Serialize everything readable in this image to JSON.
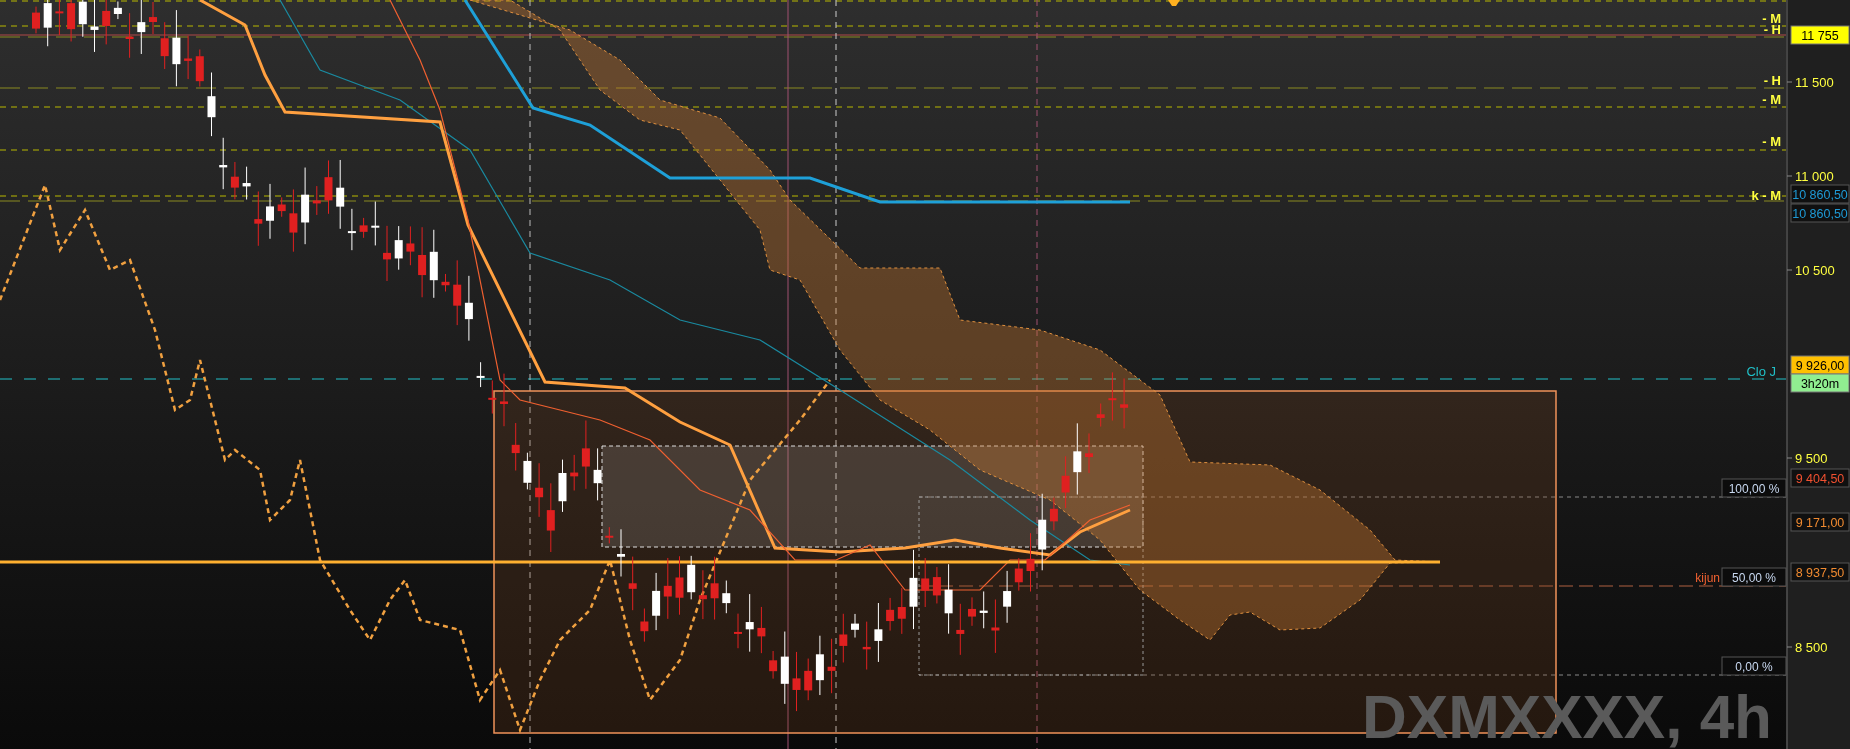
{
  "chart": {
    "level_labels": [
      "- M",
      "- H",
      "- H",
      "- M",
      "- M",
      "k - M"
    ],
    "close_label": "Clo J",
    "fib_labels": [
      {
        "text": "100,00 %"
      },
      {
        "text": "50,00 %"
      },
      {
        "text": "0,00 %"
      }
    ],
    "kijun_label": "kijun",
    "symbol_watermark": "DXMXXXX, 4h"
  },
  "price_axis": {
    "ticks": [
      "11 500",
      "11 000",
      "10 500",
      "9 500",
      "8 500"
    ],
    "price_tags": [
      {
        "text": "11 755",
        "kind": "filled",
        "color": "#ffff00"
      },
      {
        "text": "10 860,50",
        "kind": "outline",
        "color": "#1e9ad6"
      },
      {
        "text": "10 860,50",
        "kind": "outline",
        "color": "#1e9ad6"
      },
      {
        "text": "9 926,00",
        "kind": "filled",
        "color": "#ffc000"
      },
      {
        "text": "3h20m",
        "kind": "filled",
        "color": "#90ee90"
      },
      {
        "text": "9 404,50",
        "kind": "outline",
        "color": "#f05030"
      },
      {
        "text": "9 171,00",
        "kind": "outline",
        "color": "#f08a30"
      },
      {
        "text": "8 937,50",
        "kind": "outline",
        "color": "#f08a30"
      }
    ]
  }
}
